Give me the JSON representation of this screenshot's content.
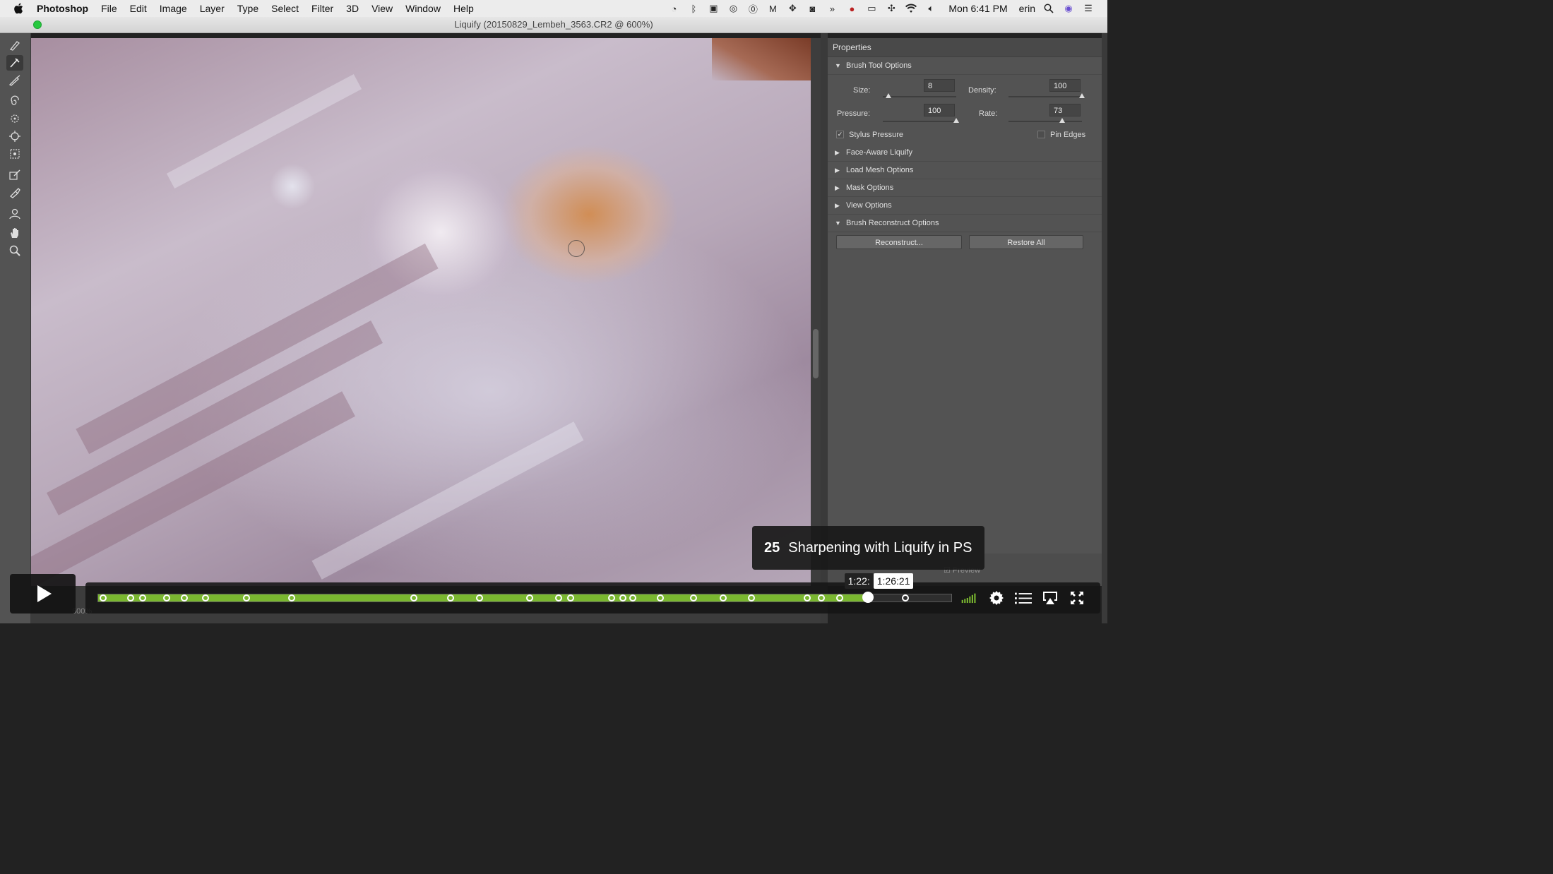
{
  "menubar": {
    "app_name": "Photoshop",
    "menus": [
      "File",
      "Edit",
      "Image",
      "Layer",
      "Type",
      "Select",
      "Filter",
      "3D",
      "View",
      "Window",
      "Help"
    ],
    "clock": "Mon 6:41 PM",
    "user": "erin"
  },
  "window": {
    "title": "Liquify (20150829_Lembeh_3563.CR2 @ 600%)"
  },
  "properties": {
    "title": "Properties",
    "brush_tool_options": {
      "label": "Brush Tool Options",
      "size_label": "Size:",
      "size_value": "8",
      "size_fraction": 0.08,
      "density_label": "Density:",
      "density_value": "100",
      "density_fraction": 1.0,
      "pressure_label": "Pressure:",
      "pressure_value": "100",
      "pressure_fraction": 1.0,
      "rate_label": "Rate:",
      "rate_value": "73",
      "rate_fraction": 0.73,
      "stylus_pressure_label": "Stylus Pressure",
      "stylus_pressure_checked": true,
      "pin_edges_label": "Pin Edges",
      "pin_edges_checked": false
    },
    "sections": {
      "face_aware": "Face-Aware Liquify",
      "load_mesh": "Load Mesh Options",
      "mask": "Mask Options",
      "view": "View Options",
      "brush_reconstruct": "Brush Reconstruct Options"
    },
    "reconstruct_button": "Reconstruct...",
    "restore_all_button": "Restore All",
    "preview_label": "Preview"
  },
  "canvas": {
    "zoom_label": "600%"
  },
  "video": {
    "chapter_number": "25",
    "chapter_title": "Sharpening with Liquify in PS",
    "progress_fraction": 0.902,
    "hover_fraction": 0.946,
    "time_current": "1:22:",
    "time_hover": "1:26:21",
    "accent_color": "#7ab730",
    "chapter_marker_fractions": [
      0.006,
      0.038,
      0.052,
      0.08,
      0.101,
      0.126,
      0.174,
      0.227,
      0.37,
      0.413,
      0.447,
      0.506,
      0.54,
      0.554,
      0.602,
      0.615,
      0.627,
      0.659,
      0.698,
      0.733,
      0.766,
      0.831,
      0.848,
      0.869,
      0.946
    ]
  }
}
